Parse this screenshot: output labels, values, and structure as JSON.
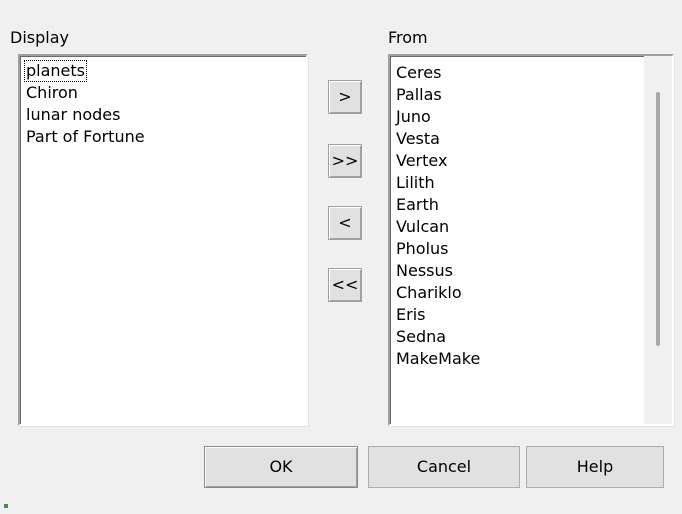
{
  "display": {
    "label": "Display",
    "items": [
      {
        "label": "planets"
      },
      {
        "label": "Chiron"
      },
      {
        "label": "lunar nodes"
      },
      {
        "label": "Part of Fortune"
      }
    ]
  },
  "from": {
    "label": "From",
    "items": [
      {
        "label": "Ceres"
      },
      {
        "label": "Pallas"
      },
      {
        "label": "Juno"
      },
      {
        "label": "Vesta"
      },
      {
        "label": "Vertex"
      },
      {
        "label": "Lilith"
      },
      {
        "label": "Earth"
      },
      {
        "label": "Vulcan"
      },
      {
        "label": "Pholus"
      },
      {
        "label": "Nessus"
      },
      {
        "label": "Chariklo"
      },
      {
        "label": "Eris"
      },
      {
        "label": "Sedna"
      },
      {
        "label": "MakeMake"
      }
    ]
  },
  "transfer": {
    "add_one": ">",
    "add_all": ">>",
    "remove_one": "<",
    "remove_all": "<<"
  },
  "buttons": {
    "ok": "OK",
    "cancel": "Cancel",
    "help": "Help"
  }
}
